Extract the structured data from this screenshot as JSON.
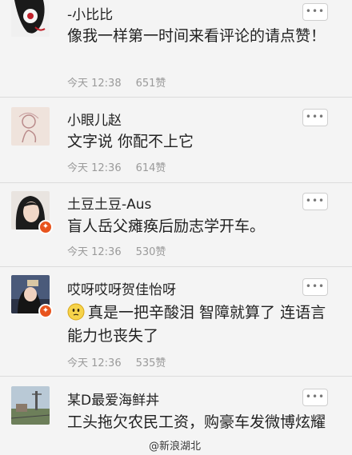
{
  "comments": [
    {
      "name": "-小比比",
      "text": "像我一样第一时间来看评论的请点赞！",
      "time": "今天 12:38",
      "likes": "651赞",
      "more": "•••",
      "verified": false
    },
    {
      "name": "小眼儿赵",
      "text": "文字说 你配不上它",
      "time": "今天 12:36",
      "likes": "614赞",
      "more": "•••",
      "verified": false
    },
    {
      "name": "土豆土豆-Aus",
      "text": "盲人岳父瘫痪后励志学开车。",
      "time": "今天 12:36",
      "likes": "530赞",
      "more": "•••",
      "verified": true
    },
    {
      "name": "哎呀哎呀贺佳怡呀",
      "text": "真是一把辛酸泪 智障就算了 连语言能力也丧失了",
      "time": "今天 12:36",
      "likes": "535赞",
      "more": "•••",
      "verified": true
    },
    {
      "name": "某D最爱海鲜丼",
      "text": "工头拖欠农民工资，购豪车发微博炫耀",
      "time": "",
      "likes": "",
      "more": "•••",
      "verified": false
    }
  ],
  "watermark": "@新浪湖北",
  "colors": {
    "background": "#f4f4f4",
    "name": "#222222",
    "meta": "#9a9a9a",
    "verified_badge": "#e8541e"
  }
}
